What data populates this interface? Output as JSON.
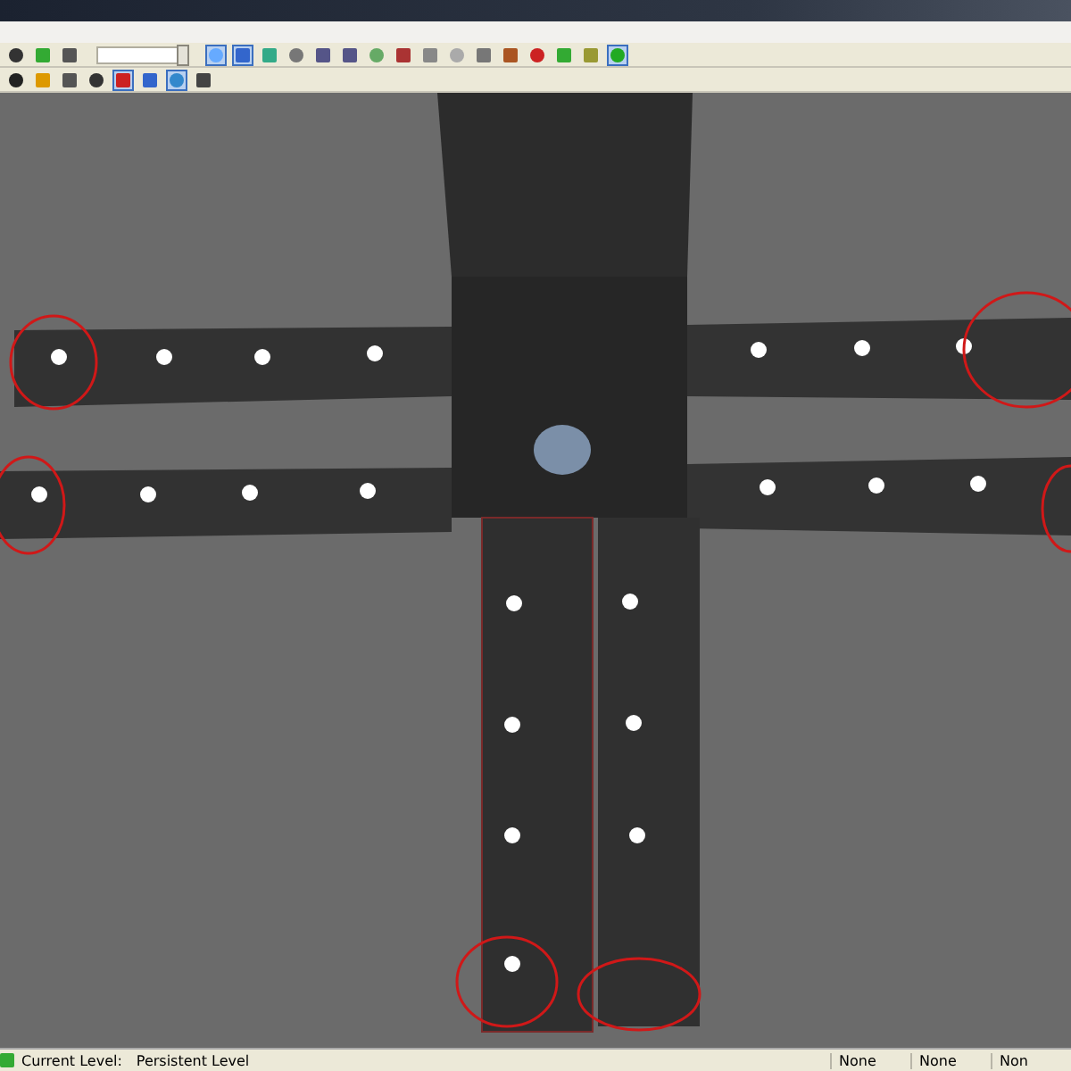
{
  "toolbar": {
    "row_1": [
      {
        "selected": false
      },
      {
        "selected": false
      },
      {
        "selected": false
      },
      {
        "selected": true
      },
      {
        "selected": true
      },
      {
        "selected": false
      },
      {
        "selected": false
      },
      {
        "selected": false
      },
      {
        "selected": false
      },
      {
        "selected": false
      },
      {
        "selected": false
      },
      {
        "selected": false
      },
      {
        "selected": false
      },
      {
        "selected": false
      },
      {
        "selected": false
      },
      {
        "selected": false
      },
      {
        "selected": false
      },
      {
        "selected": false
      },
      {
        "selected": true
      }
    ],
    "slider": {
      "level": 1
    },
    "row_2": [
      {
        "selected": false
      },
      {
        "selected": false
      },
      {
        "selected": false
      },
      {
        "selected": false
      },
      {
        "selected": true
      },
      {
        "selected": false
      },
      {
        "selected": true
      },
      {
        "selected": false
      }
    ]
  },
  "status_bar": {
    "label": "Current Level:",
    "value": "Persistent Level",
    "fields": [
      "None",
      "None",
      "Non"
    ]
  }
}
